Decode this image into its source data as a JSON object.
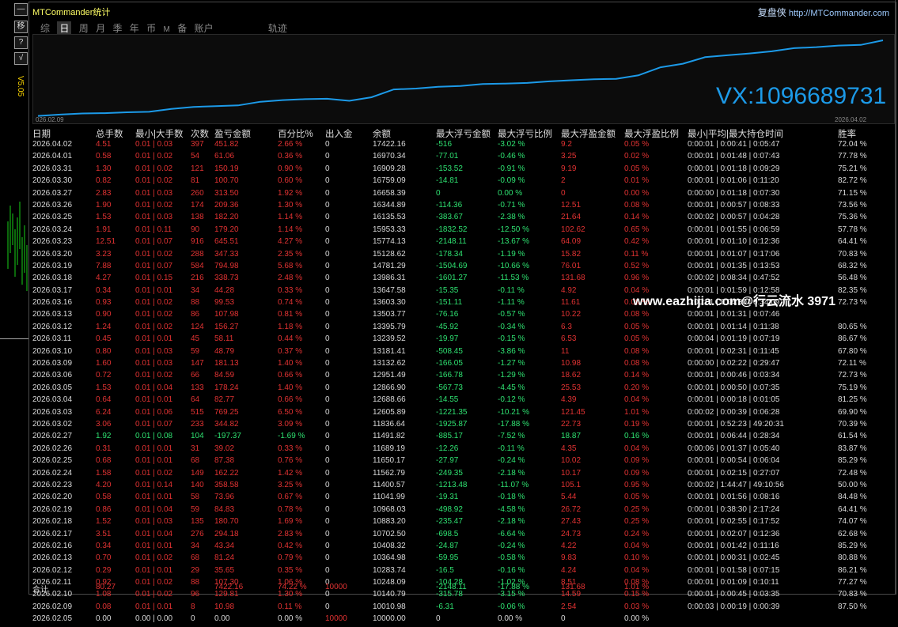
{
  "left": {
    "buttons": [
      "—",
      "移",
      "?",
      "√"
    ],
    "version": "V5.05"
  },
  "app": {
    "title": "MTCommander统计",
    "brand_cn": "复盘侠",
    "brand_url": "http://MTCommander.com"
  },
  "tabs": [
    "综",
    "日",
    "周",
    "月",
    "季",
    "年",
    "币",
    "M",
    "备",
    "账户",
    "轨迹"
  ],
  "active_tab": "日",
  "chart": {
    "start_label": "026.02.09",
    "end_label": "2026.04.02",
    "overlay": "VX:1096689731",
    "line_color": "#1c9ae8",
    "values": [
      10010.98,
      10140.79,
      10248.09,
      10283.74,
      10364.98,
      10408.32,
      10702.5,
      10883.2,
      10968.03,
      11041.99,
      11400.57,
      11562.79,
      11650.17,
      11689.19,
      11491.82,
      11836.64,
      12605.89,
      12688.66,
      12866.9,
      12951.49,
      13132.62,
      13181.41,
      13239.52,
      13395.79,
      13503.77,
      13603.3,
      13647.58,
      13986.31,
      14781.29,
      15128.62,
      15774.13,
      15953.33,
      16135.53,
      16344.89,
      16658.39,
      16759.09,
      16909.28,
      16970.34,
      17422.16
    ]
  },
  "headers": [
    "日期",
    "总手数",
    "最小|大手数",
    "次数",
    "盈亏金额",
    "百分比%",
    "出入金",
    "余额",
    "最大浮亏金额",
    "最大浮亏比例",
    "最大浮盈金额",
    "最大浮盈比例",
    "最小|平均|最大持仓时间",
    "胜率"
  ],
  "rows": [
    {
      "c": "r",
      "v": [
        "2026.04.02",
        "4.51",
        "0.01 | 0.03",
        "397",
        "451.82",
        "2.66 %",
        "0",
        "17422.16",
        "-516",
        "-3.02 %",
        "9.2",
        "0.05 %",
        "0:00:01 | 0:00:41 | 0:05:47",
        "72.04 %"
      ]
    },
    {
      "c": "r",
      "v": [
        "2026.04.01",
        "0.58",
        "0.01 | 0.02",
        "54",
        "61.06",
        "0.36 %",
        "0",
        "16970.34",
        "-77.01",
        "-0.46 %",
        "3.25",
        "0.02 %",
        "0:00:01 | 0:01:48 | 0:07:43",
        "77.78 %"
      ]
    },
    {
      "c": "r",
      "v": [
        "2026.03.31",
        "1.30",
        "0.01 | 0.02",
        "121",
        "150.19",
        "0.90 %",
        "0",
        "16909.28",
        "-153.52",
        "-0.91 %",
        "9.19",
        "0.05 %",
        "0:00:01 | 0:01:18 | 0:09:29",
        "75.21 %"
      ]
    },
    {
      "c": "r",
      "v": [
        "2026.03.30",
        "0.82",
        "0.01 | 0.02",
        "81",
        "100.70",
        "0.60 %",
        "0",
        "16759.09",
        "-14.81",
        "-0.09 %",
        "2",
        "0.01 %",
        "0:00:01 | 0:01:06 | 0:11:20",
        "82.72 %"
      ]
    },
    {
      "c": "r",
      "v": [
        "2026.03.27",
        "2.83",
        "0.01 | 0.03",
        "260",
        "313.50",
        "1.92 %",
        "0",
        "16658.39",
        "0",
        "0.00 %",
        "0",
        "0.00 %",
        "0:00:00 | 0:01:18 | 0:07:30",
        "71.15 %"
      ]
    },
    {
      "c": "r",
      "v": [
        "2026.03.26",
        "1.90",
        "0.01 | 0.02",
        "174",
        "209.36",
        "1.30 %",
        "0",
        "16344.89",
        "-114.36",
        "-0.71 %",
        "12.51",
        "0.08 %",
        "0:00:01 | 0:00:57 | 0:08:33",
        "73.56 %"
      ]
    },
    {
      "c": "r",
      "v": [
        "2026.03.25",
        "1.53",
        "0.01 | 0.03",
        "138",
        "182.20",
        "1.14 %",
        "0",
        "16135.53",
        "-383.67",
        "-2.38 %",
        "21.64",
        "0.14 %",
        "0:00:02 | 0:00:57 | 0:04:28",
        "75.36 %"
      ]
    },
    {
      "c": "r",
      "v": [
        "2026.03.24",
        "1.91",
        "0.01 | 0.11",
        "90",
        "179.20",
        "1.14 %",
        "0",
        "15953.33",
        "-1832.52",
        "-12.50 %",
        "102.62",
        "0.65 %",
        "0:00:01 | 0:01:55 | 0:06:59",
        "57.78 %"
      ]
    },
    {
      "c": "r",
      "v": [
        "2026.03.23",
        "12.51",
        "0.01 | 0.07",
        "916",
        "645.51",
        "4.27 %",
        "0",
        "15774.13",
        "-2148.11",
        "-13.67 %",
        "64.09",
        "0.42 %",
        "0:00:01 | 0:01:10 | 0:12:36",
        "64.41 %"
      ]
    },
    {
      "c": "r",
      "v": [
        "2026.03.20",
        "3.23",
        "0.01 | 0.02",
        "288",
        "347.33",
        "2.35 %",
        "0",
        "15128.62",
        "-178.34",
        "-1.19 %",
        "15.82",
        "0.11 %",
        "0:00:01 | 0:01:07 | 0:17:06",
        "70.83 %"
      ]
    },
    {
      "c": "r",
      "v": [
        "2026.03.19",
        "7.88",
        "0.01 | 0.07",
        "584",
        "794.98",
        "5.68 %",
        "0",
        "14781.29",
        "-1504.69",
        "-10.66 %",
        "76.01",
        "0.52 %",
        "0:00:01 | 0:01:35 | 0:13:53",
        "68.32 %"
      ]
    },
    {
      "c": "r",
      "v": [
        "2026.03.18",
        "4.27",
        "0.01 | 0.15",
        "216",
        "338.73",
        "2.48 %",
        "0",
        "13986.31",
        "-1601.27",
        "-11.53 %",
        "131.68",
        "0.96 %",
        "0:00:02 | 0:08:34 | 0:47:52",
        "56.48 %"
      ]
    },
    {
      "c": "r",
      "v": [
        "2026.03.17",
        "0.34",
        "0.01 | 0.01",
        "34",
        "44.28",
        "0.33 %",
        "0",
        "13647.58",
        "-15.35",
        "-0.11 %",
        "4.92",
        "0.04 %",
        "0:00:01 | 0:01:59 | 0:12:58",
        "82.35 %"
      ]
    },
    {
      "c": "r",
      "v": [
        "2026.03.16",
        "0.93",
        "0.01 | 0.02",
        "88",
        "99.53",
        "0.74 %",
        "0",
        "13603.30",
        "-151.11",
        "-1.11 %",
        "11.61",
        "0.09 %",
        "0:00:01 | 0:04:30 | 0:34:09",
        "72.73 %"
      ]
    },
    {
      "c": "r",
      "v": [
        "2026.03.13",
        "0.90",
        "0.01 | 0.02",
        "86",
        "107.98",
        "0.81 %",
        "0",
        "13503.77",
        "-76.16",
        "-0.57 %",
        "10.22",
        "0.08 %",
        "0:00:01 | 0:01:31 | 0:07:46",
        "",
        ""
      ]
    },
    {
      "c": "r",
      "v": [
        "2026.03.12",
        "1.24",
        "0.01 | 0.02",
        "124",
        "156.27",
        "1.18 %",
        "0",
        "13395.79",
        "-45.92",
        "-0.34 %",
        "6.3",
        "0.05 %",
        "0:00:01 | 0:01:14 | 0:11:38",
        "80.65 %"
      ]
    },
    {
      "c": "r",
      "v": [
        "2026.03.11",
        "0.45",
        "0.01 | 0.01",
        "45",
        "58.11",
        "0.44 %",
        "0",
        "13239.52",
        "-19.97",
        "-0.15 %",
        "6.53",
        "0.05 %",
        "0:00:04 | 0:01:19 | 0:07:19",
        "86.67 %"
      ]
    },
    {
      "c": "r",
      "v": [
        "2026.03.10",
        "0.80",
        "0.01 | 0.03",
        "59",
        "48.79",
        "0.37 %",
        "0",
        "13181.41",
        "-508.45",
        "-3.86 %",
        "11",
        "0.08 %",
        "0:00:01 | 0:02:31 | 0:11:45",
        "67.80 %"
      ]
    },
    {
      "c": "r",
      "v": [
        "2026.03.09",
        "1.60",
        "0.01 | 0.03",
        "147",
        "181.13",
        "1.40 %",
        "0",
        "13132.62",
        "-166.05",
        "-1.27 %",
        "10.98",
        "0.08 %",
        "0:00:00 | 0:02:22 | 0:29:47",
        "72.11 %"
      ]
    },
    {
      "c": "r",
      "v": [
        "2026.03.06",
        "0.72",
        "0.01 | 0.02",
        "66",
        "84.59",
        "0.66 %",
        "0",
        "12951.49",
        "-166.78",
        "-1.29 %",
        "18.62",
        "0.14 %",
        "0:00:01 | 0:00:46 | 0:03:34",
        "72.73 %"
      ]
    },
    {
      "c": "r",
      "v": [
        "2026.03.05",
        "1.53",
        "0.01 | 0.04",
        "133",
        "178.24",
        "1.40 %",
        "0",
        "12866.90",
        "-567.73",
        "-4.45 %",
        "25.53",
        "0.20 %",
        "0:00:01 | 0:00:50 | 0:07:35",
        "75.19 %"
      ]
    },
    {
      "c": "r",
      "v": [
        "2026.03.04",
        "0.64",
        "0.01 | 0.01",
        "64",
        "82.77",
        "0.66 %",
        "0",
        "12688.66",
        "-14.55",
        "-0.12 %",
        "4.39",
        "0.04 %",
        "0:00:01 | 0:00:18 | 0:01:05",
        "81.25 %"
      ]
    },
    {
      "c": "r",
      "v": [
        "2026.03.03",
        "6.24",
        "0.01 | 0.06",
        "515",
        "769.25",
        "6.50 %",
        "0",
        "12605.89",
        "-1221.35",
        "-10.21 %",
        "121.45",
        "1.01 %",
        "0:00:02 | 0:00:39 | 0:06:28",
        "69.90 %"
      ]
    },
    {
      "c": "r",
      "v": [
        "2026.03.02",
        "3.06",
        "0.01 | 0.07",
        "233",
        "344.82",
        "3.09 %",
        "0",
        "11836.64",
        "-1925.87",
        "-17.88 %",
        "22.73",
        "0.19 %",
        "0:00:01 | 0:52:23 | 49:20:31",
        "70.39 %"
      ]
    },
    {
      "c": "g",
      "v": [
        "2026.02.27",
        "1.92",
        "0.01 | 0.08",
        "104",
        "-197.37",
        "-1.69 %",
        "0",
        "11491.82",
        "-885.17",
        "-7.52 %",
        "18.87",
        "0.16 %",
        "0:00:01 | 0:06:44 | 0:28:34",
        "61.54 %"
      ]
    },
    {
      "c": "r",
      "v": [
        "2026.02.26",
        "0.31",
        "0.01 | 0.01",
        "31",
        "39.02",
        "0.33 %",
        "0",
        "11689.19",
        "-12.26",
        "-0.11 %",
        "4.35",
        "0.04 %",
        "0:00:06 | 0:01:37 | 0:05:40",
        "83.87 %"
      ]
    },
    {
      "c": "r",
      "v": [
        "2026.02.25",
        "0.68",
        "0.01 | 0.01",
        "68",
        "87.38",
        "0.76 %",
        "0",
        "11650.17",
        "-27.97",
        "-0.24 %",
        "10.02",
        "0.09 %",
        "0:00:01 | 0:00:54 | 0:06:04",
        "85.29 %"
      ]
    },
    {
      "c": "r",
      "v": [
        "2026.02.24",
        "1.58",
        "0.01 | 0.02",
        "149",
        "162.22",
        "1.42 %",
        "0",
        "11562.79",
        "-249.35",
        "-2.18 %",
        "10.17",
        "0.09 %",
        "0:00:01 | 0:02:15 | 0:27:07",
        "72.48 %"
      ]
    },
    {
      "c": "r",
      "v": [
        "2026.02.23",
        "4.20",
        "0.01 | 0.14",
        "140",
        "358.58",
        "3.25 %",
        "0",
        "11400.57",
        "-1213.48",
        "-11.07 %",
        "105.1",
        "0.95 %",
        "0:00:02 | 1:44:47 | 49:10:56",
        "50.00 %"
      ]
    },
    {
      "c": "r",
      "v": [
        "2026.02.20",
        "0.58",
        "0.01 | 0.01",
        "58",
        "73.96",
        "0.67 %",
        "0",
        "11041.99",
        "-19.31",
        "-0.18 %",
        "5.44",
        "0.05 %",
        "0:00:01 | 0:01:56 | 0:08:16",
        "84.48 %"
      ]
    },
    {
      "c": "r",
      "v": [
        "2026.02.19",
        "0.86",
        "0.01 | 0.04",
        "59",
        "84.83",
        "0.78 %",
        "0",
        "10968.03",
        "-498.92",
        "-4.58 %",
        "26.72",
        "0.25 %",
        "0:00:01 | 0:38:30 | 2:17:24",
        "64.41 %"
      ]
    },
    {
      "c": "r",
      "v": [
        "2026.02.18",
        "1.52",
        "0.01 | 0.03",
        "135",
        "180.70",
        "1.69 %",
        "0",
        "10883.20",
        "-235.47",
        "-2.18 %",
        "27.43",
        "0.25 %",
        "0:00:01 | 0:02:55 | 0:17:52",
        "74.07 %"
      ]
    },
    {
      "c": "r",
      "v": [
        "2026.02.17",
        "3.51",
        "0.01 | 0.04",
        "276",
        "294.18",
        "2.83 %",
        "0",
        "10702.50",
        "-698.5",
        "-6.64 %",
        "24.73",
        "0.24 %",
        "0:00:01 | 0:02:07 | 0:12:36",
        "62.68 %"
      ]
    },
    {
      "c": "r",
      "v": [
        "2026.02.16",
        "0.34",
        "0.01 | 0.01",
        "34",
        "43.34",
        "0.42 %",
        "0",
        "10408.32",
        "-24.87",
        "-0.24 %",
        "4.22",
        "0.04 %",
        "0:00:01 | 0:01:42 | 0:11:16",
        "85.29 %"
      ]
    },
    {
      "c": "r",
      "v": [
        "2026.02.13",
        "0.70",
        "0.01 | 0.02",
        "68",
        "81.24",
        "0.79 %",
        "0",
        "10364.98",
        "-59.95",
        "-0.58 %",
        "9.83",
        "0.10 %",
        "0:00:01 | 0:00:31 | 0:02:45",
        "80.88 %"
      ]
    },
    {
      "c": "r",
      "v": [
        "2026.02.12",
        "0.29",
        "0.01 | 0.01",
        "29",
        "35.65",
        "0.35 %",
        "0",
        "10283.74",
        "-16.5",
        "-0.16 %",
        "4.24",
        "0.04 %",
        "0:00:01 | 0:01:58 | 0:07:15",
        "86.21 %"
      ]
    },
    {
      "c": "r",
      "v": [
        "2026.02.11",
        "0.92",
        "0.01 | 0.02",
        "88",
        "107.30",
        "1.06 %",
        "0",
        "10248.09",
        "-104.28",
        "-1.02 %",
        "8.51",
        "0.08 %",
        "0:00:01 | 0:01:09 | 0:10:11",
        "77.27 %"
      ]
    },
    {
      "c": "r",
      "v": [
        "2026.02.10",
        "1.08",
        "0.01 | 0.02",
        "96",
        "129.81",
        "1.30 %",
        "0",
        "10140.79",
        "-315.78",
        "-3.15 %",
        "14.59",
        "0.15 %",
        "0:00:01 | 0:00:45 | 0:03:35",
        "70.83 %"
      ]
    },
    {
      "c": "r",
      "v": [
        "2026.02.09",
        "0.08",
        "0.01 | 0.01",
        "8",
        "10.98",
        "0.11 %",
        "0",
        "10010.98",
        "-6.31",
        "-0.06 %",
        "2.54",
        "0.03 %",
        "0:00:03 | 0:00:19 | 0:00:39",
        "87.50 %"
      ]
    },
    {
      "c": "w",
      "v": [
        "2026.02.05",
        "0.00",
        "0.00 | 0.00",
        "0",
        "0.00",
        "0.00 %",
        "10000",
        "10000.00",
        "0",
        "0.00 %",
        "0",
        "0.00 %",
        "",
        ""
      ]
    }
  ],
  "total": {
    "label": "合计",
    "lots": "80.27",
    "pnl": "7422.16",
    "pct": "74.22 %",
    "inout": "10000",
    "maxloss": "-2148.11",
    "maxloss_pct": "-17.88 %",
    "maxprofit": "131.68",
    "maxprofit_pct": "1.01 %"
  },
  "watermark": "www.eazhijia.com@行云流水 3971"
}
